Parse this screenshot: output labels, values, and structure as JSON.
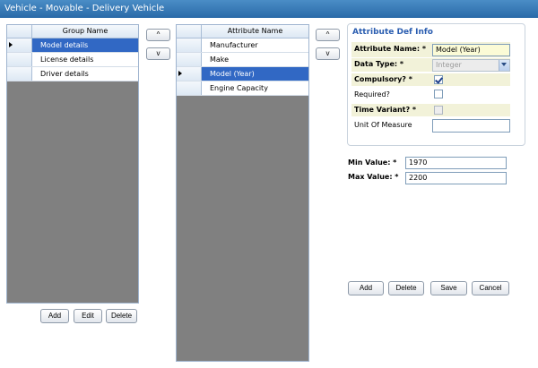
{
  "window": {
    "title": "Vehicle - Movable - Delivery Vehicle"
  },
  "groups": {
    "column_header": "Group Name",
    "rows": [
      "Model details",
      "License details",
      "Driver details"
    ],
    "selected_index": 0,
    "buttons": {
      "add": "Add",
      "edit": "Edit",
      "delete": "Delete"
    },
    "move_up": "^",
    "move_down": "v"
  },
  "attributes": {
    "column_header": "Attribute Name",
    "rows": [
      "Manufacturer",
      "Make",
      "Model (Year)",
      "Engine Capacity"
    ],
    "selected_index": 2,
    "move_up": "^",
    "move_down": "v"
  },
  "def_info": {
    "title": "Attribute Def Info",
    "attribute_name_label": "Attribute Name: *",
    "attribute_name_value": "Model (Year)",
    "data_type_label": "Data Type: *",
    "data_type_value": "Integer",
    "compulsory_label": "Compulsory? *",
    "compulsory_checked": true,
    "required_label": "Required?",
    "required_checked": false,
    "time_variant_label": "Time Variant? *",
    "time_variant_checked": false,
    "unit_label": "Unit Of Measure",
    "unit_value": ""
  },
  "range": {
    "min_label": "Min Value: *",
    "min_value": "1970",
    "max_label": "Max Value: *",
    "max_value": "2200"
  },
  "actions": {
    "add": "Add",
    "delete": "Delete",
    "save": "Save",
    "cancel": "Cancel"
  },
  "colors": {
    "title_bar": "#2a6aa8",
    "selection": "#3168c4",
    "grid_background": "#808080"
  }
}
